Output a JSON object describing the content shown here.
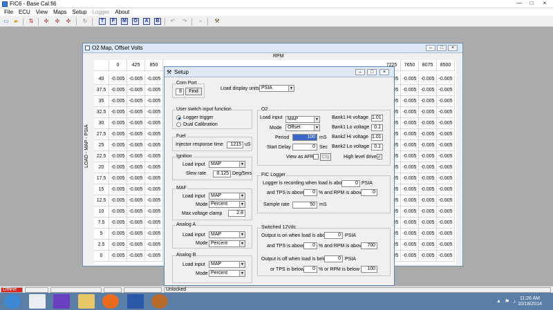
{
  "app": {
    "title": "FIC6 - Base Cal.fi6",
    "min": "—",
    "max": "□",
    "close": "×"
  },
  "menu": [
    "File",
    "ECU",
    "View",
    "Maps",
    "Setup",
    "Logger",
    "About"
  ],
  "toolbar_letters": [
    "T",
    "F",
    "M",
    "O",
    "A",
    "B"
  ],
  "map_window": {
    "title": "O2 Map, Offset Volts",
    "x_axis_label": "RPM",
    "y_axis_label": "LOAD - MAP - PSIA",
    "rpm_visible_left": [
      "0",
      "425",
      "850"
    ],
    "rpm_visible_right": [
      "7225",
      "7650",
      "8075",
      "8500"
    ],
    "loads": [
      "40",
      "37.5",
      "35",
      "32.5",
      "30",
      "27.5",
      "25",
      "22.5",
      "20",
      "17.5",
      "15",
      "12.5",
      "10",
      "7.5",
      "5",
      "2.5",
      "0"
    ],
    "cell_value": "-0.005"
  },
  "setup": {
    "title": "Setup",
    "com_port": {
      "label": "Com Port",
      "value": "8",
      "button": "Find"
    },
    "load_display": {
      "label": "Load display units",
      "value": "PSIA"
    },
    "user_switch": {
      "label": "User switch input function",
      "options": [
        "Logger trigger",
        "Dual Calibration"
      ],
      "selected": 0
    },
    "fuel": {
      "label": "Fuel",
      "field": "Injector response time",
      "value": "1215",
      "unit": "uS"
    },
    "ignition": {
      "label": "Ignition",
      "load_input_label": "Load input",
      "load_input": "MAP",
      "slew_label": "Slew rate",
      "slew": "0.125",
      "slew_unit": "Deg/5ms"
    },
    "maf": {
      "label": "MAF",
      "load_input_label": "Load input",
      "load_input": "MAP",
      "mode_label": "Mode",
      "mode": "Percent",
      "clamp_label": "Max voltage clamp",
      "clamp": "2.8"
    },
    "analog_a": {
      "label": "Analog A",
      "load_input_label": "Load input",
      "load_input": "MAP",
      "mode_label": "Mode",
      "mode": "Percent"
    },
    "analog_b": {
      "label": "Analog B",
      "load_input_label": "Load input",
      "load_input": "MAP",
      "mode_label": "Mode",
      "mode": "Percent"
    },
    "o2": {
      "label": "O2",
      "load_input_label": "Load input",
      "load_input": "MAP",
      "mode_label": "Mode",
      "mode": "Offset",
      "period_label": "Period",
      "period": "100",
      "period_unit": "mS",
      "start_delay_label": "Start Delay",
      "start_delay": "0",
      "start_delay_unit": "Sec",
      "view_afr_label": "View as AFR",
      "afr_button": "Cfg",
      "bank1_hi_label": "Bank1 Hi voltage",
      "bank1_hi": "1.01",
      "bank1_lo_label": "Bank1 Lo voltage",
      "bank1_lo": "0.1",
      "bank2_hi_label": "Bank2 Hi voltage",
      "bank2_hi": "1.01",
      "bank2_lo_label": "Bank2 Lo voltage",
      "bank2_lo": "0.1",
      "high_level_label": "High level drive"
    },
    "fic_logger": {
      "label": "FIC Logger",
      "line1": "Logger is recording when load is above",
      "load": "0",
      "load_unit": "PSIA",
      "tps_label": "and TPS is above",
      "tps": "0",
      "rpm_label": "%  and RPM is above",
      "rpm": "0",
      "sample_label": "Sample rate",
      "sample": "50",
      "sample_unit": "mS"
    },
    "switched": {
      "label": "Switched 12Vdc",
      "on_label": "Output is on when load is above",
      "on_load": "0",
      "unit": "PSIA",
      "on_tps_label": "and TPS is above",
      "on_tps": "0",
      "on_rpm_label": "%  and RPM is above",
      "on_rpm": "700",
      "off_label": "Output is off when load is below",
      "off_load": "0",
      "off_tps_label": "or TPS is below",
      "off_tps": "0",
      "off_rpm_label": "%  or RPM is below",
      "off_rpm": "100"
    }
  },
  "status": {
    "left": "Offline",
    "lock": "Unlocked"
  },
  "clock": {
    "time": "11:26 AM",
    "date": "10/18/2014"
  }
}
